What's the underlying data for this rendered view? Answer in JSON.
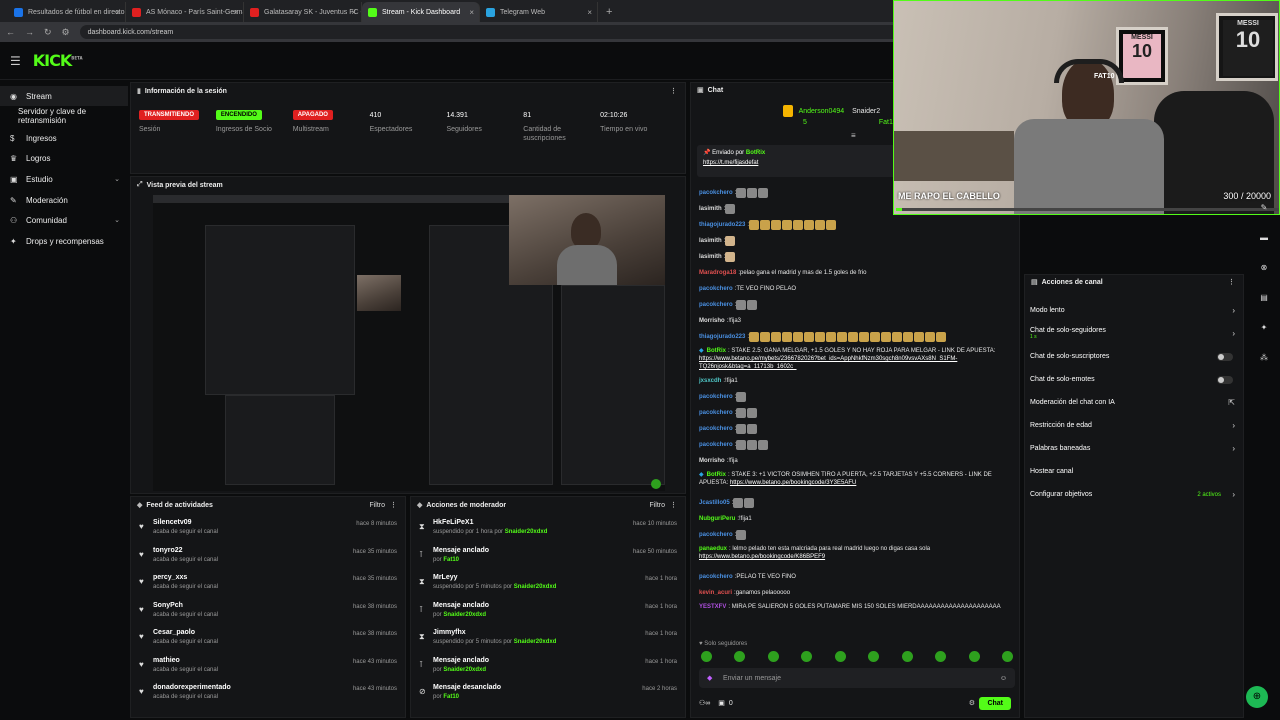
{
  "browser": {
    "tabs": [
      {
        "title": "Resultados de fútbol en directo",
        "color": "#1a73e8"
      },
      {
        "title": "AS Mónaco - París Saint-Germain",
        "color": "#e02020"
      },
      {
        "title": "Galatasaray SK - Juventus FC C",
        "color": "#e02020"
      },
      {
        "title": "Stream - Kick Dashboard",
        "color": "#53fc18"
      },
      {
        "title": "Telegram Web",
        "color": "#2aa3df"
      }
    ],
    "url": "dashboard.kick.com/stream"
  },
  "brand": {
    "logo": "KICK",
    "logo_sup": "BETA",
    "accent": "#53fc18"
  },
  "sidebar": {
    "items": [
      {
        "label": "Stream",
        "icon": "radio-icon"
      },
      {
        "label": "Servidor y clave de retransmisión",
        "icon": ""
      },
      {
        "label": "Ingresos",
        "icon": "dollar-icon"
      },
      {
        "label": "Logros",
        "icon": "trophy-icon"
      },
      {
        "label": "Estudio",
        "icon": "studio-icon"
      },
      {
        "label": "Moderación",
        "icon": "wrench-icon"
      },
      {
        "label": "Comunidad",
        "icon": "users-icon"
      },
      {
        "label": "Drops y recompensas",
        "icon": "gift-icon"
      }
    ]
  },
  "session": {
    "title": "Información de la sesión",
    "stats": [
      {
        "value": "TRANSMITIENDO",
        "label": "Sesión",
        "kind": "badge-red"
      },
      {
        "value": "ENCENDIDO",
        "label": "Ingresos de Socio",
        "kind": "badge-green"
      },
      {
        "value": "APAGADO",
        "label": "Multistream",
        "kind": "badge-red"
      },
      {
        "value": "410",
        "label": "Espectadores",
        "kind": "text"
      },
      {
        "value": "14.391",
        "label": "Seguidores",
        "kind": "text"
      },
      {
        "value": "81",
        "label": "Cantidad de suscripciones",
        "kind": "text"
      },
      {
        "value": "02:10:26",
        "label": "Tiempo en vivo",
        "kind": "text"
      }
    ]
  },
  "preview": {
    "title": "Vista previa del stream"
  },
  "feed": {
    "title": "Feed de actividades",
    "filter": "Filtro",
    "items": [
      {
        "name": "Silencetv09",
        "sub": "acaba de seguir el canal",
        "time": "hace 8 minutos"
      },
      {
        "name": "tonyro22",
        "sub": "acaba de seguir el canal",
        "time": "hace 35 minutos"
      },
      {
        "name": "percy_xxs",
        "sub": "acaba de seguir el canal",
        "time": "hace 35 minutos"
      },
      {
        "name": "SonyPch",
        "sub": "acaba de seguir el canal",
        "time": "hace 38 minutos"
      },
      {
        "name": "Cesar_paolo",
        "sub": "acaba de seguir el canal",
        "time": "hace 38 minutos"
      },
      {
        "name": "mathieo",
        "sub": "acaba de seguir el canal",
        "time": "hace 43 minutos"
      },
      {
        "name": "donadorexperimentado",
        "sub": "acaba de seguir el canal",
        "time": "hace 43 minutos"
      }
    ]
  },
  "modactions": {
    "title": "Acciones de moderador",
    "filter": "Filtro",
    "items": [
      {
        "icon": "hourglass-icon",
        "name": "HkFeLiPeX1",
        "sub": "suspendido por 1 hora por",
        "by": "Snaider20xdxd",
        "time": "hace 10 minutos"
      },
      {
        "icon": "pin-icon",
        "name": "Mensaje anclado",
        "sub": "por",
        "by": "Fat10",
        "time": "hace 50 minutos"
      },
      {
        "icon": "hourglass-icon",
        "name": "MrLeyy",
        "sub": "suspendido por 5 minutos por",
        "by": "Snaider20xdxd",
        "time": "hace 1 hora"
      },
      {
        "icon": "pin-icon",
        "name": "Mensaje anclado",
        "sub": "por",
        "by": "Snaider20xdxd",
        "time": "hace 1 hora"
      },
      {
        "icon": "hourglass-icon",
        "name": "Jimmyfhx",
        "sub": "suspendido por 5 minutos por",
        "by": "Snaider20xdxd",
        "time": "hace 1 hora"
      },
      {
        "icon": "pin-icon",
        "name": "Mensaje anclado",
        "sub": "por",
        "by": "Snaider20xdxd",
        "time": "hace 1 hora"
      },
      {
        "icon": "unpin-icon",
        "name": "Mensaje desanclado",
        "sub": "por",
        "by": "Fat10",
        "time": "hace 2 horas"
      }
    ]
  },
  "chat": {
    "title": "Chat",
    "top_users": [
      {
        "name": "Anderson0494",
        "count": "5"
      },
      {
        "name": "Snaider2",
        "count": ""
      },
      {
        "name": "Fat10",
        "count": ""
      }
    ],
    "pinned": {
      "label": "Enviado por",
      "by": "BotRix",
      "link": "https://t.me/fijasdefat"
    },
    "messages": [
      {
        "user": "pacokchero",
        "color": "#4a90e2",
        "text": "",
        "emotes": 3,
        "emote": "g"
      },
      {
        "user": "lasimith",
        "color": "#ddd",
        "text": "",
        "emotes": 1,
        "emote": "g"
      },
      {
        "user": "thiagojurado223",
        "color": "#4a90e2",
        "text": "",
        "emotes": 8,
        "emote": "y"
      },
      {
        "user": "lasimith",
        "color": "#ddd",
        "text": "",
        "emotes": 1,
        "emote": "p"
      },
      {
        "user": "lasimith",
        "color": "#ddd",
        "text": "",
        "emotes": 1,
        "emote": "p"
      },
      {
        "user": "Maradroga18",
        "color": "#e05050",
        "text": "pelao gana el madrid y mas de 1.5 goles de frio",
        "emotes": 0
      },
      {
        "user": "pacokchero",
        "color": "#4a90e2",
        "text": "TE VEO FINO PELAO",
        "emotes": 0
      },
      {
        "user": "pacokchero",
        "color": "#4a90e2",
        "text": "",
        "emotes": 2,
        "emote": "g"
      },
      {
        "user": "Morrisho",
        "color": "#ddd",
        "text": "!fija3",
        "emotes": 0
      },
      {
        "user": "thiagojurado223",
        "color": "#4a90e2",
        "text": "",
        "emotes": 18,
        "emote": "y"
      },
      {
        "user": "BotRix",
        "color": "#53fc18",
        "text": "STAKE 2.5: GANA MELGAR, +1.5 GOLES Y NO HAY ROJA PARA MELGAR - LINK DE APUESTA:",
        "link": "https://www.betano.pe/mybets/2366782026?bet_ids=AppNhkfNzm30sgch8n09vsvAXs8N_S1FM-TQ26njosk&btag=a_11713b_1602c_",
        "multi": true
      },
      {
        "user": "jxsxcdh",
        "color": "#50c8c8",
        "text": "!fija1",
        "emotes": 0
      },
      {
        "user": "pacokchero",
        "color": "#4a90e2",
        "text": "",
        "emotes": 1,
        "emote": "g"
      },
      {
        "user": "pacokchero",
        "color": "#4a90e2",
        "text": "",
        "emotes": 2,
        "emote": "g"
      },
      {
        "user": "pacokchero",
        "color": "#4a90e2",
        "text": "",
        "emotes": 2,
        "emote": "g"
      },
      {
        "user": "pacokchero",
        "color": "#4a90e2",
        "text": "",
        "emotes": 3,
        "emote": "g"
      },
      {
        "user": "Morrisho",
        "color": "#ddd",
        "text": "!fija",
        "emotes": 0
      },
      {
        "user": "BotRix",
        "color": "#53fc18",
        "text": "STAKE 3: +1 VICTOR OSIMHEN TIRO A PUERTA, +2.5 TARJETAS Y +5.5 CORNERS - LINK DE APUESTA:",
        "link": "https://www.betano.pe/bookingcode/3Y3E5AFU",
        "multi": true
      },
      {
        "user": "Jcastillo05",
        "color": "#4a90e2",
        "text": "",
        "emotes": 2,
        "emote": "g"
      },
      {
        "user": "NubguriPeru",
        "color": "#53fc18",
        "text": "!fija1",
        "emotes": 0
      },
      {
        "user": "pacokchero",
        "color": "#4a90e2",
        "text": "",
        "emotes": 1,
        "emote": "g"
      },
      {
        "user": "panaedux",
        "color": "#53fc18",
        "text": "lelmo pelado ten esta malcriada para real madrid luego no digas casa sola",
        "link": "https://www.betano.pe/bookingcode/K86BPEF9",
        "multi": true
      },
      {
        "user": "pacokchero",
        "color": "#4a90e2",
        "text": "PELAO TE VEO FINO",
        "emotes": 0
      },
      {
        "user": "kevin_acuri",
        "color": "#e05050",
        "text": "ganamos pelaooooo",
        "emotes": 0
      },
      {
        "user": "YESTXFV",
        "color": "#b050e0",
        "text": "MIRA PE SALIERON 5 GOLES PUTAMARE MIS 150 SOLES MIERDAAAAAAAAAAAAAAAAAAAAA",
        "multi": true
      }
    ],
    "followers_only": "Solo seguidores",
    "input_placeholder": "Enviar un mensaje",
    "viewers_small": "0",
    "send_label": "Chat"
  },
  "webcam": {
    "title": "ME RAPO EL CABELLO",
    "count": "300",
    "goal": "/ 20000",
    "progress": 0.015,
    "jersey1": "MESSI",
    "jersey2": "MESSI",
    "num": "10",
    "cap": "FAT10"
  },
  "channel_actions": {
    "title": "Acciones de canal",
    "items": [
      {
        "label": "Modo lento",
        "kind": "chev",
        "sub": ""
      },
      {
        "label": "Chat de solo-seguidores",
        "kind": "chev",
        "sub": "1 s"
      },
      {
        "label": "Chat de solo-suscriptores",
        "kind": "toggle",
        "sub": ""
      },
      {
        "label": "Chat de solo-emotes",
        "kind": "toggle",
        "sub": ""
      },
      {
        "label": "Moderación del chat con IA",
        "kind": "ext",
        "sub": ""
      },
      {
        "label": "Restricción de edad",
        "kind": "chev",
        "sub": ""
      },
      {
        "label": "Palabras baneadas",
        "kind": "chev",
        "sub": ""
      },
      {
        "label": "Hostear canal",
        "kind": "none",
        "sub": ""
      },
      {
        "label": "Configurar objetivos",
        "kind": "chev",
        "sub": "",
        "badge": "2 activos"
      }
    ]
  }
}
